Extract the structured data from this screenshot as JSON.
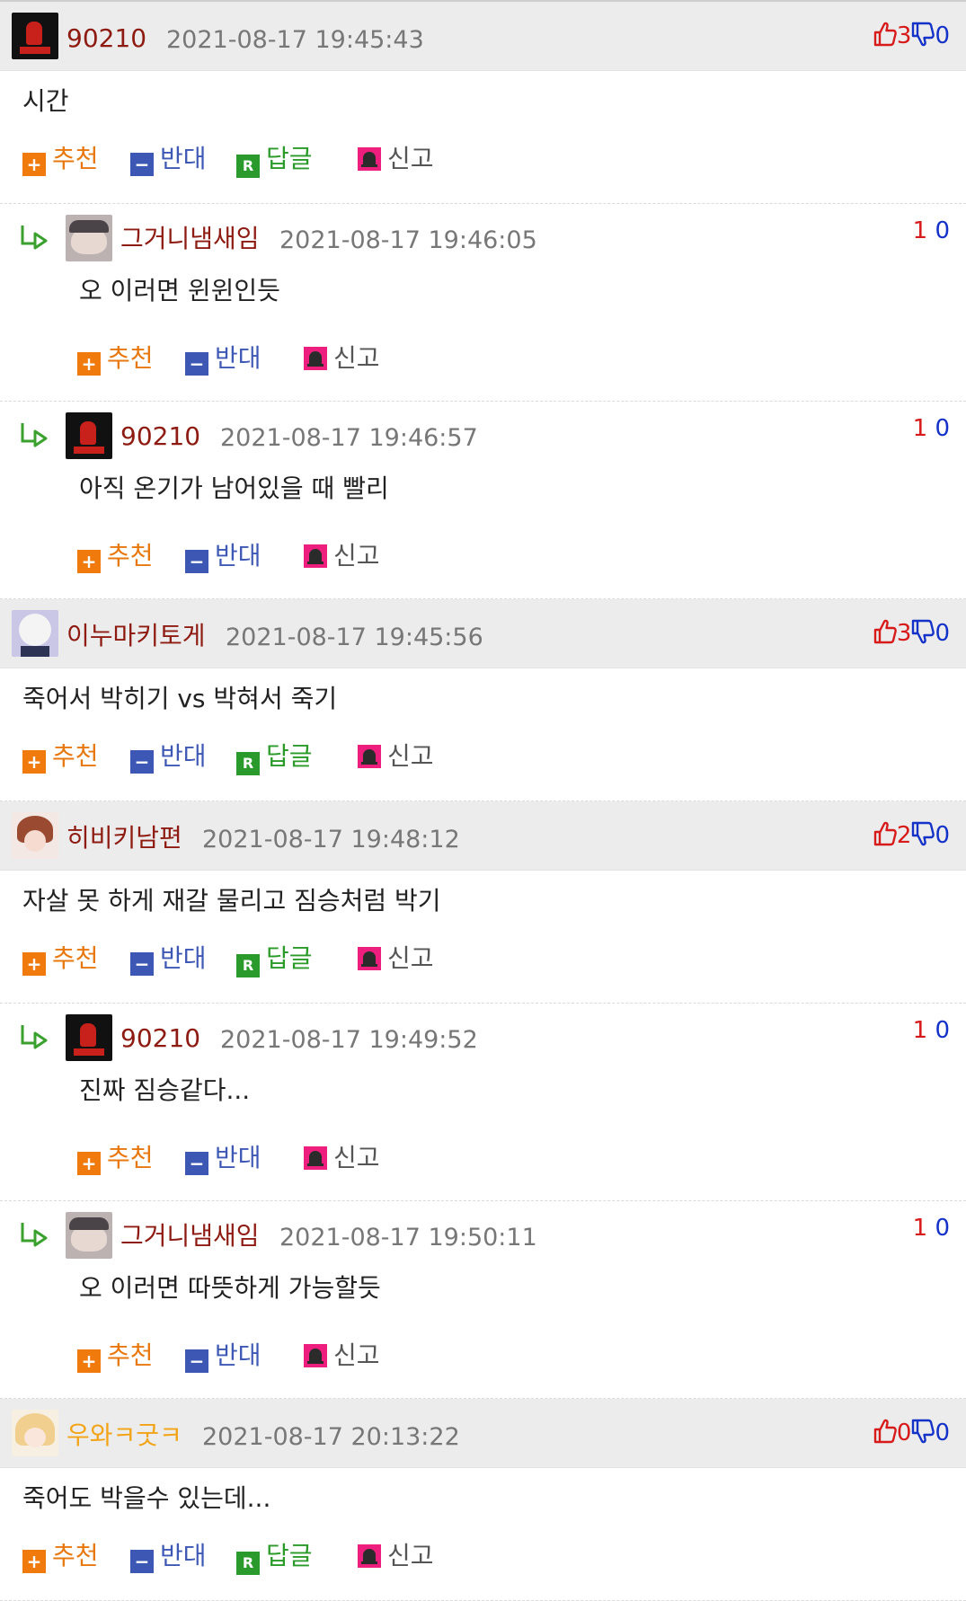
{
  "actions": {
    "recommend": "추천",
    "oppose": "반대",
    "reply": "답글",
    "report": "신고",
    "plus_icon": "+",
    "minus_icon": "−",
    "reply_icon": "R"
  },
  "comments": [
    {
      "kind": "top",
      "avatar": "a-90210",
      "user": "90210",
      "time": "2021-08-17 19:45:43",
      "text": "시간",
      "up": "3",
      "down": "0"
    },
    {
      "kind": "reply",
      "avatar": "a-cat",
      "user": "그거니냄새임",
      "time": "2021-08-17 19:46:05",
      "text": "오 이러면 윈윈인듯",
      "up": "1",
      "down": "0"
    },
    {
      "kind": "reply",
      "avatar": "a-90210",
      "user": "90210",
      "time": "2021-08-17 19:46:57",
      "text": "아직 온기가 남어있을 때 빨리",
      "up": "1",
      "down": "0"
    },
    {
      "kind": "top",
      "avatar": "a-white",
      "user": "이누마키토게",
      "time": "2021-08-17 19:45:56",
      "text": "죽어서 박히기 vs 박혀서 죽기",
      "up": "3",
      "down": "0"
    },
    {
      "kind": "top",
      "avatar": "a-brown",
      "user": "히비키남편",
      "time": "2021-08-17 19:48:12",
      "text": "자살 못 하게 재갈 물리고 짐승처럼 박기",
      "up": "2",
      "down": "0"
    },
    {
      "kind": "reply",
      "avatar": "a-90210",
      "user": "90210",
      "time": "2021-08-17 19:49:52",
      "text": "진짜 짐승같다...",
      "up": "1",
      "down": "0"
    },
    {
      "kind": "reply",
      "avatar": "a-cat",
      "user": "그거니냄새임",
      "time": "2021-08-17 19:50:11",
      "text": "오 이러면 따뜻하게 가능할듯",
      "up": "1",
      "down": "0"
    },
    {
      "kind": "top",
      "avatar": "a-blonde",
      "user": "우와ㅋ굿ㅋ",
      "user_color": "gold",
      "time": "2021-08-17 20:13:22",
      "text": "죽어도 박을수 있는데...",
      "up": "0",
      "down": "0"
    }
  ]
}
